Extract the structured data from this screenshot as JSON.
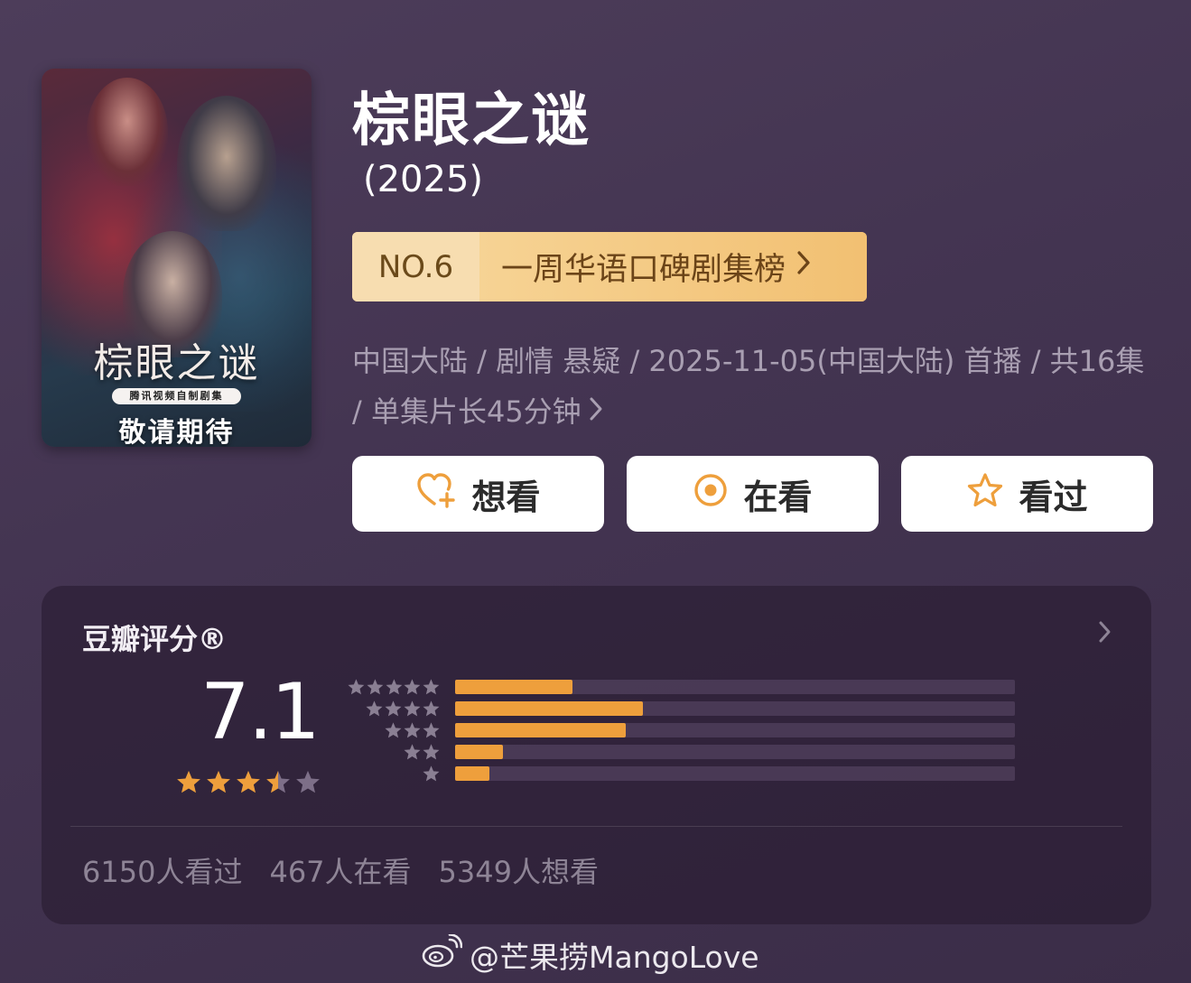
{
  "poster": {
    "title_text": "棕眼之谜",
    "tag_text": "腾讯视频自制剧集",
    "sub_text": "敬请期待"
  },
  "header": {
    "title": "棕眼之谜",
    "year": " (2025)"
  },
  "ranking": {
    "number": "NO.6",
    "list_name": "一周华语口碑剧集榜"
  },
  "meta": {
    "line": "中国大陆 / 剧情 悬疑 / 2025-11-05(中国大陆) 首播 / 共16集 / 单集片长45分钟"
  },
  "actions": {
    "want": "想看",
    "watching": "在看",
    "watched": "看过"
  },
  "rating": {
    "label": "豆瓣评分®",
    "score": "7.1",
    "stars_value": 3.5,
    "distribution": [
      {
        "stars": 5,
        "fraction": 0.21
      },
      {
        "stars": 4,
        "fraction": 0.335
      },
      {
        "stars": 3,
        "fraction": 0.305
      },
      {
        "stars": 2,
        "fraction": 0.085
      },
      {
        "stars": 1,
        "fraction": 0.062
      }
    ],
    "counts": {
      "watched": "6150人看过",
      "watching": "467人在看",
      "want": "5349人想看"
    }
  },
  "colors": {
    "accent_orange": "#ee9f3c",
    "rank_gold": "#f3c77a",
    "background": "#453653"
  },
  "watermark": {
    "text": "@芒果捞MangoLove"
  }
}
